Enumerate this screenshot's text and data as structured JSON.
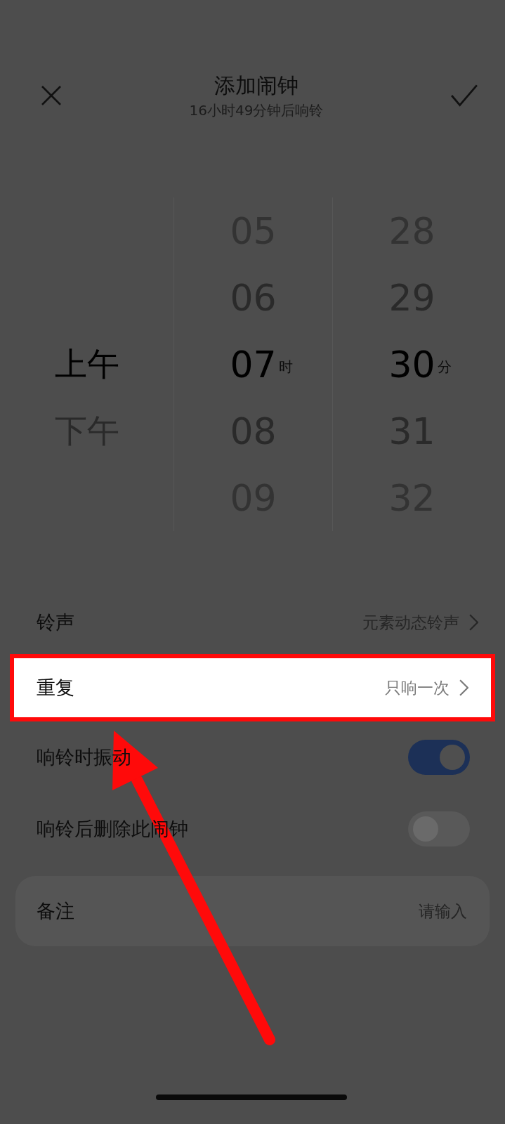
{
  "header": {
    "title": "添加闹钟",
    "subtitle": "16小时49分钟后响铃"
  },
  "picker": {
    "period": [
      {
        "label": "上午",
        "selected": true
      },
      {
        "label": "下午",
        "selected": false
      }
    ],
    "hours": [
      {
        "label": "05",
        "selected": false
      },
      {
        "label": "06",
        "selected": false
      },
      {
        "label": "07",
        "selected": true
      },
      {
        "label": "08",
        "selected": false
      },
      {
        "label": "09",
        "selected": false
      }
    ],
    "hour_unit": "时",
    "minutes": [
      {
        "label": "28",
        "selected": false
      },
      {
        "label": "29",
        "selected": false
      },
      {
        "label": "30",
        "selected": true
      },
      {
        "label": "31",
        "selected": false
      },
      {
        "label": "32",
        "selected": false
      }
    ],
    "minute_unit": "分"
  },
  "settings": [
    {
      "kind": "link",
      "label": "铃声",
      "value": "元素动态铃声",
      "highlighted": false
    },
    {
      "kind": "link",
      "label": "重复",
      "value": "只响一次",
      "highlighted": true
    },
    {
      "kind": "toggle",
      "label": "响铃时振动",
      "on": true
    },
    {
      "kind": "toggle",
      "label": "响铃后删除此闹钟",
      "on": false
    }
  ],
  "note": {
    "label": "备注",
    "placeholder": "请输入"
  }
}
